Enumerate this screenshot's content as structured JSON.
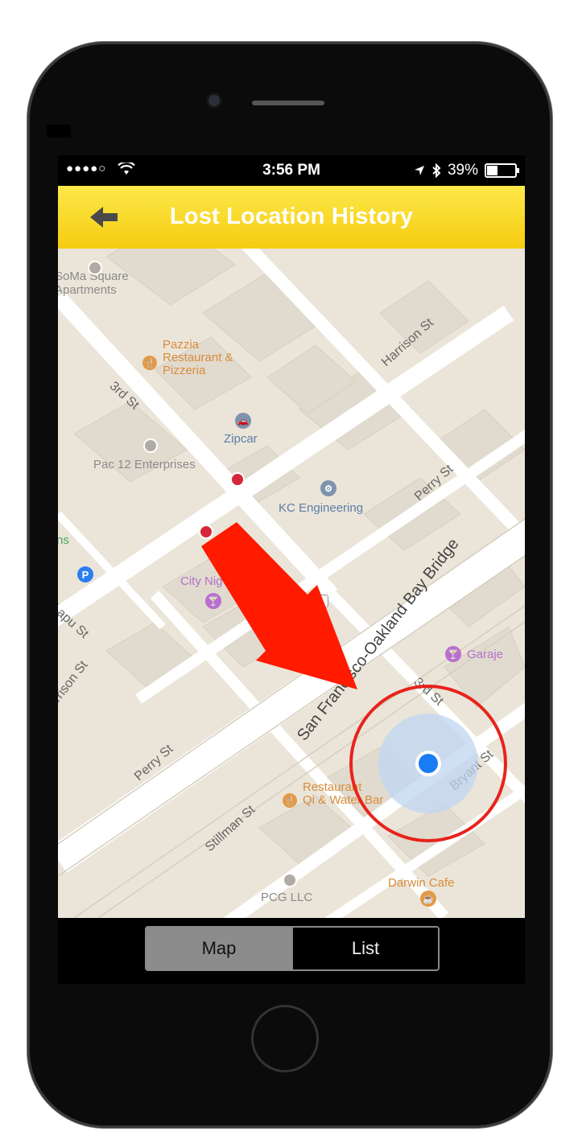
{
  "status_bar": {
    "time": "3:56 PM",
    "battery": "39%",
    "signal": "●●●●○"
  },
  "nav": {
    "title": "Lost Location History",
    "back_icon": "back-arrow-icon"
  },
  "map": {
    "places": {
      "soma": "SoMa Square\nApartments",
      "pazzia": "Pazzia\nRestaurant &\nPizzeria",
      "zipcar": "Zipcar",
      "pac12": "Pac 12 Enterprises",
      "kc": "KC Engineering",
      "citynights": "City Nig",
      "garaje": "Garaje",
      "qi": "Restaurant\nQi & Water Bar",
      "pcg": "PCG LLC",
      "darwin": "Darwin Cafe",
      "ns": "ns"
    },
    "streets": {
      "harrison_top": "Harrison St",
      "third_top": "3rd St",
      "perry_top": "Perry St",
      "bay_bridge": "San Francisco-Oakland Bay Bridge",
      "harrison_bottom": "arrison St",
      "lapu": "Lapu St",
      "perry_bottom": "Perry St",
      "third_bottom": "3rd St",
      "bryant": "Bryant St",
      "stillman": "Stillman St"
    }
  },
  "tabs": {
    "map": "Map",
    "list": "List",
    "selected": "Map"
  },
  "colors": {
    "nav": "#f6cc10",
    "arrow": "#ff1a00",
    "location_dot": "#1a7cf5",
    "highlight_circle": "#e8231c"
  }
}
